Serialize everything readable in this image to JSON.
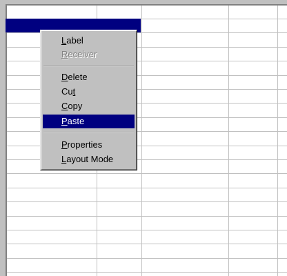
{
  "menu": {
    "label": {
      "mnemonic": "L",
      "rest": "abel"
    },
    "receiver": {
      "mnemonic": "R",
      "rest": "eceiver",
      "enabled": false
    },
    "delete": {
      "mnemonic": "D",
      "rest": "elete"
    },
    "cut": {
      "pre": "Cu",
      "mnemonic": "t"
    },
    "copy": {
      "mnemonic": "C",
      "rest": "opy"
    },
    "paste": {
      "mnemonic": "P",
      "rest": "aste",
      "highlighted": true
    },
    "properties": {
      "mnemonic": "P",
      "rest": "roperties"
    },
    "layout_mode": {
      "mnemonic": "L",
      "rest": "ayout Mode"
    }
  },
  "colors": {
    "highlight": "#000080",
    "face": "#c0c0c0",
    "grid_line": "#c0c0c0"
  }
}
